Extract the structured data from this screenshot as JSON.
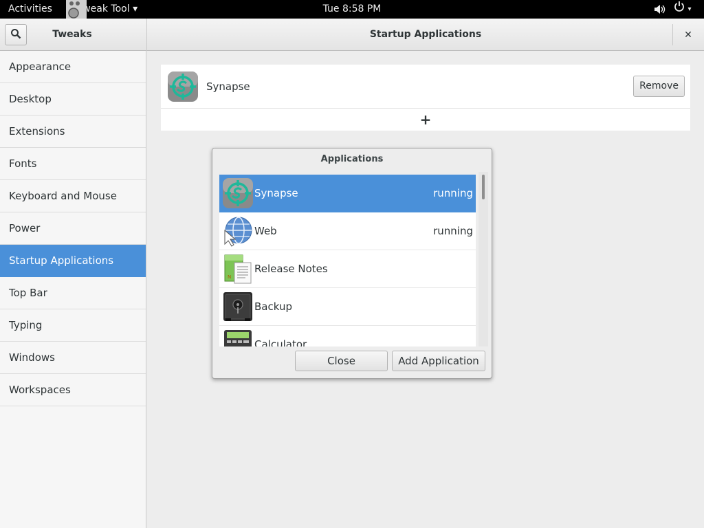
{
  "top_bar": {
    "activities": "Activities",
    "app_menu": "Tweak Tool ▾",
    "clock": "Tue  8:58 PM",
    "power_arrow": "▾"
  },
  "header": {
    "sidebar_title": "Tweaks",
    "page_title": "Startup Applications",
    "close": "✕"
  },
  "sidebar": {
    "items": [
      {
        "label": "Appearance"
      },
      {
        "label": "Desktop"
      },
      {
        "label": "Extensions"
      },
      {
        "label": "Fonts"
      },
      {
        "label": "Keyboard and Mouse"
      },
      {
        "label": "Power"
      },
      {
        "label": "Startup Applications"
      },
      {
        "label": "Top Bar"
      },
      {
        "label": "Typing"
      },
      {
        "label": "Windows"
      },
      {
        "label": "Workspaces"
      }
    ],
    "selected_index": 6
  },
  "startup": {
    "entries": [
      {
        "name": "Synapse",
        "icon": "synapse-icon",
        "remove_label": "Remove"
      }
    ],
    "add_label": "+"
  },
  "dialog": {
    "title": "Applications",
    "apps": [
      {
        "name": "Synapse",
        "status": "running",
        "icon": "synapse-icon",
        "selected": true
      },
      {
        "name": "Web",
        "status": "running",
        "icon": "web-browser-icon",
        "selected": false
      },
      {
        "name": "Release Notes",
        "status": "",
        "icon": "release-notes-icon",
        "selected": false
      },
      {
        "name": "Backup",
        "status": "",
        "icon": "backup-safe-icon",
        "selected": false
      },
      {
        "name": "Calculator",
        "status": "",
        "icon": "calculator-icon",
        "selected": false
      }
    ],
    "close_label": "Close",
    "add_label": "Add Application"
  },
  "colors": {
    "accent": "#4a90d9",
    "top_bar": "#000000",
    "synapse_teal": "#1fb89a"
  }
}
